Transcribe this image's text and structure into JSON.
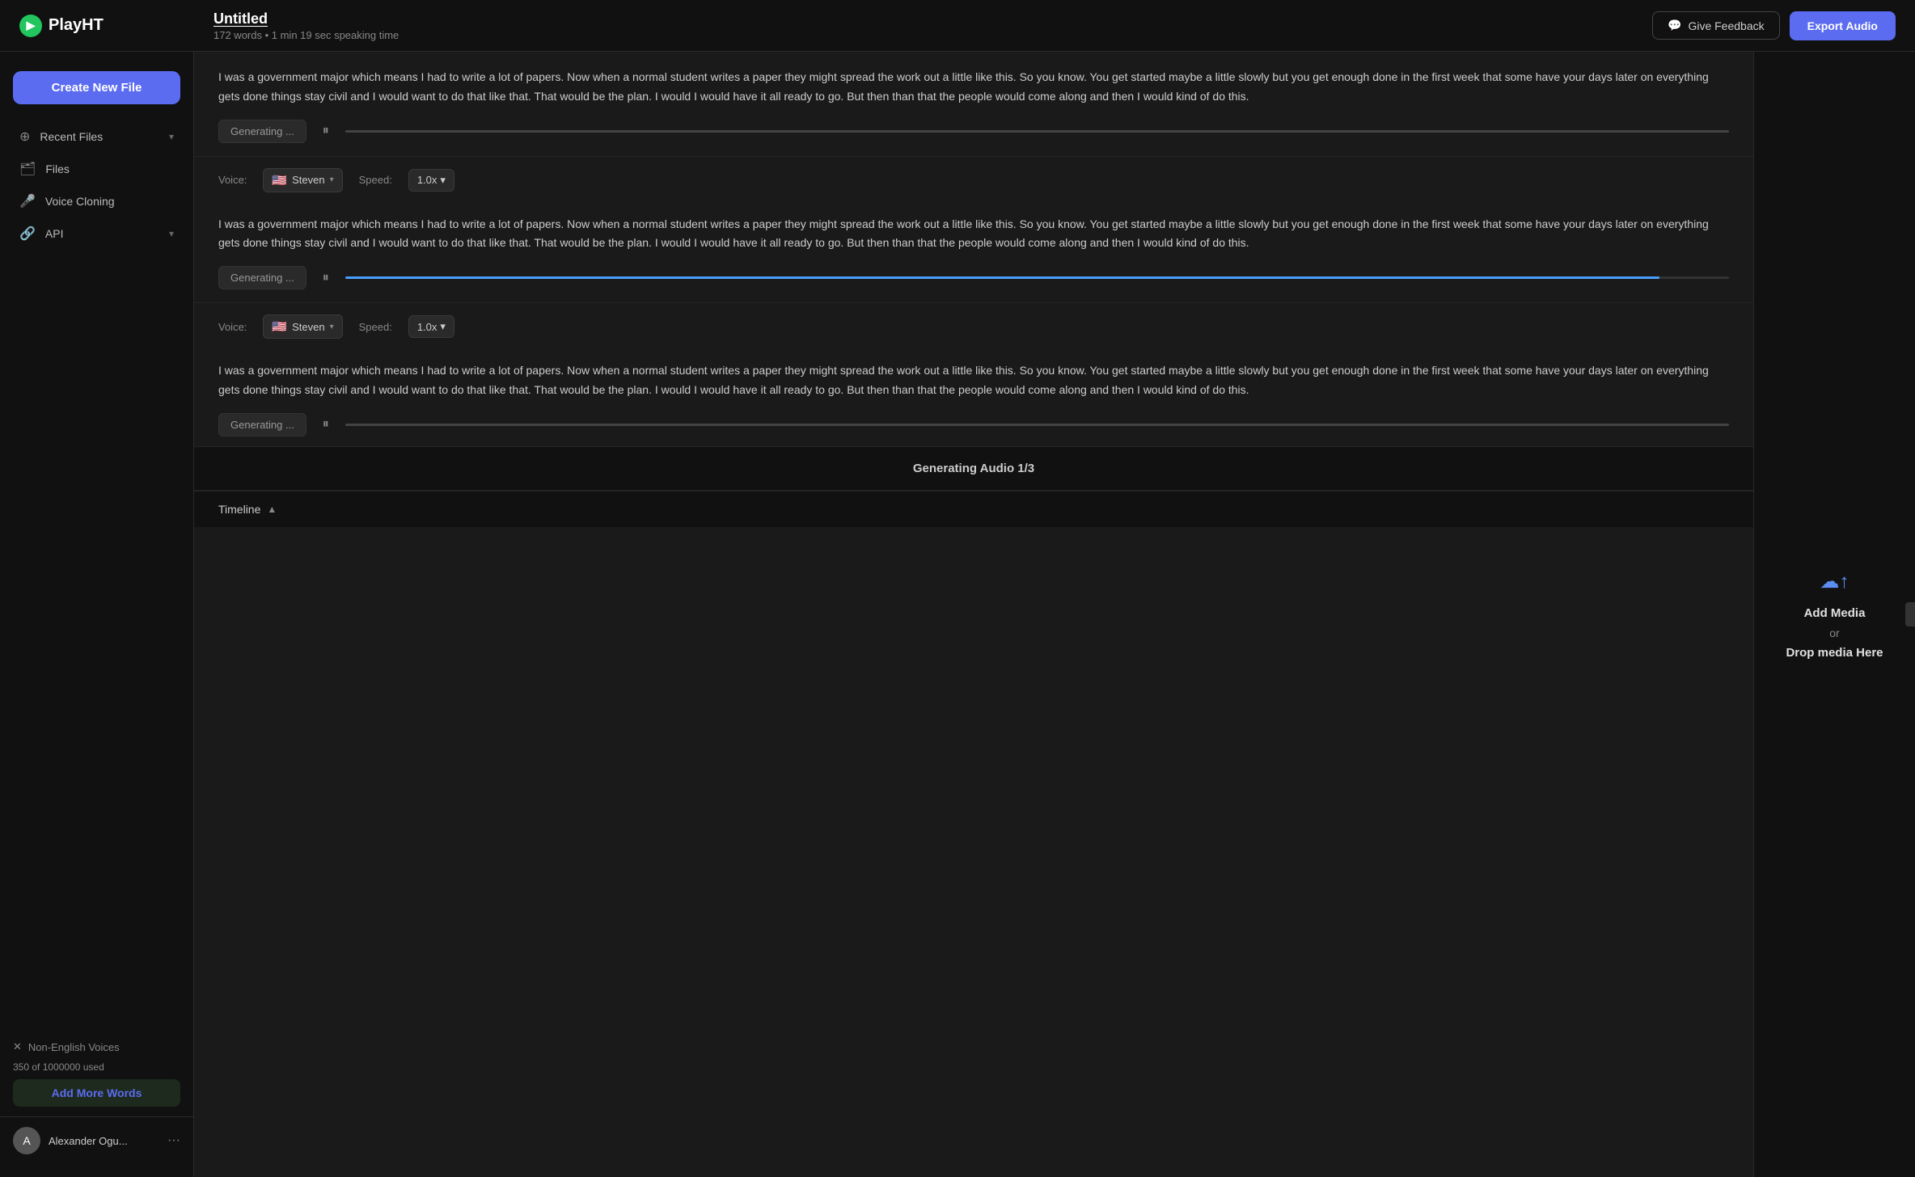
{
  "topbar": {
    "logo_text": "PlayHT",
    "logo_icon": "▶",
    "doc_title": "Untitled",
    "doc_meta": "172 words  •  1 min 19 sec speaking time",
    "feedback_label": "Give Feedback",
    "export_label": "Export Audio"
  },
  "sidebar": {
    "create_label": "Create New File",
    "items": [
      {
        "id": "recent-files",
        "icon": "⊕",
        "label": "Recent Files",
        "has_chevron": true
      },
      {
        "id": "files",
        "icon": "🗂",
        "label": "Files",
        "has_chevron": false
      },
      {
        "id": "voice-cloning",
        "icon": "🎙",
        "label": "Voice Cloning",
        "has_chevron": false
      },
      {
        "id": "api",
        "icon": "🔗",
        "label": "API",
        "has_chevron": true
      }
    ],
    "non_english_label": "Non-English Voices",
    "words_used": "350 of 1000000 used",
    "add_words_label": "Add More Words",
    "user_name": "Alexander Ogu...",
    "user_initial": "A"
  },
  "editor": {
    "blocks": [
      {
        "id": "block1",
        "text": "I was a government major which means I had to write a lot of papers. Now when a normal student writes a paper they might spread the work out a little like this. So you know. You get started maybe a little slowly but you get enough done in the first week that some have your days later on everything gets done things stay civil and I would want to do that like that. That would be the plan. I would I would have it all ready to go. But then than that the people would come along and then I would kind of do this.",
        "status": "Generating ...",
        "progress": 0,
        "has_progress": false
      },
      {
        "id": "block2",
        "voice": "Steven",
        "speed": "1.0x",
        "flag": "🇺🇸",
        "text": "I was a government major which means I had to write a lot of papers. Now when a normal student writes a paper they might spread the work out a little like this. So you know. You get started maybe a little slowly but you get enough done in the first week that some have your days later on everything gets done things stay civil and I would want to do that like that. That would be the plan. I would I would have it all ready to go. But then than that the people would come along and then I would kind of do this.",
        "status": "Generating ...",
        "progress": 95,
        "has_progress": true,
        "progress_color": "#4a9eff"
      },
      {
        "id": "block3",
        "voice": "Steven",
        "speed": "1.0x",
        "flag": "🇺🇸",
        "text": "I was a government major which means I had to write a lot of papers. Now when a normal student writes a paper they might spread the work out a little like this. So you know. You get started maybe a little slowly but you get enough done in the first week that some have your days later on everything gets done things stay civil and I would want to do that like that. That would be the plan. I would I would have it all ready to go. But then than that the people would come along and then I would kind of do this.",
        "status": "Generating ...",
        "progress": 0,
        "has_progress": false
      }
    ],
    "generating_footer": "Generating Audio 1/3",
    "timeline_label": "Timeline"
  },
  "right_panel": {
    "upload_icon": "☁",
    "media_label": "Add Media",
    "or_label": "or",
    "drop_label": "Drop media Here"
  }
}
